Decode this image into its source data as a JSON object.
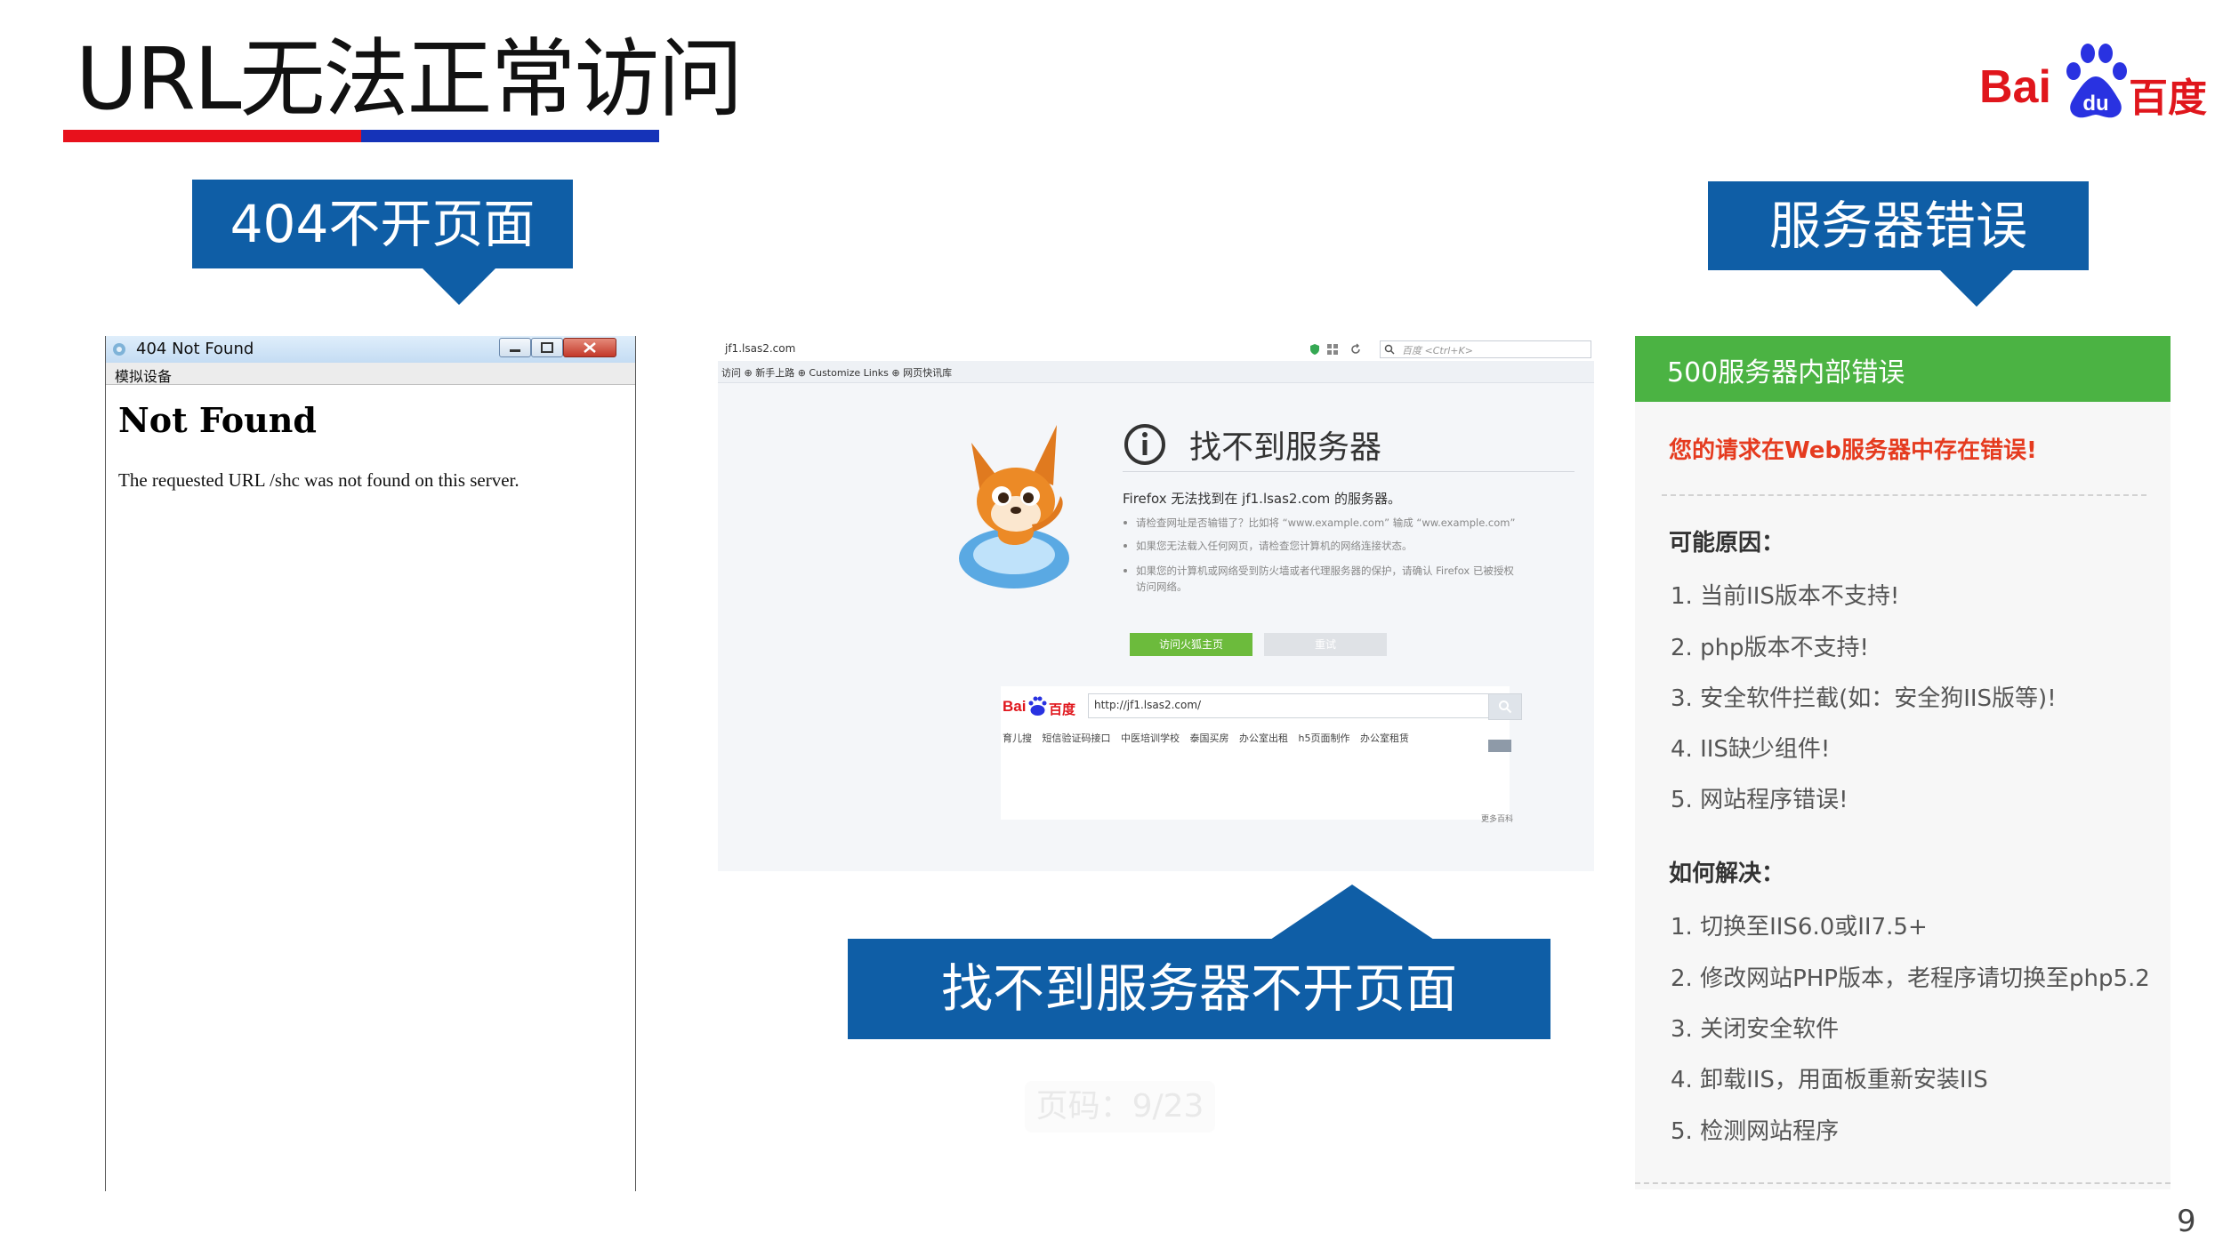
{
  "title": "URL无法正常访问",
  "logo": {
    "latin": "Bai",
    "paw": "du",
    "chinese": "百度"
  },
  "callouts": {
    "c404": "404不开页面",
    "server_error": "服务器错误",
    "not_found_server": "找不到服务器不开页面"
  },
  "window_404": {
    "title": "404 Not Found",
    "menu": "模拟设备",
    "heading": "Not Found",
    "message": "The requested URL /shc was not found on this server."
  },
  "firefox": {
    "url": "jf1.lsas2.com",
    "search_placeholder": "百度 <Ctrl+K>",
    "bookmarks": "访问  ⊕ 新手上路  ⊕ Customize Links  ⊕ 网页快讯库",
    "heading": "找不到服务器",
    "subtitle": "Firefox 无法找到在 jf1.lsas2.com 的服务器。",
    "bullets": [
      "请检查网址是否输错了？比如将 “www.example.com” 输成 “ww.example.com”",
      "如果您无法载入任何网页，请检查您计算机的网络连接状态。",
      "如果您的计算机或网络受到防火墙或者代理服务器的保护，请确认 Firefox 已被授权",
      "访问网络。"
    ],
    "button_home": "访问火狐主页",
    "button_retry": "重试",
    "baidu_logo_text": "Bai",
    "baidu_logo_cn": "百度",
    "baidu_input": "http://jf1.lsas2.com/",
    "baidu_links": "育儿搜  短信验证码接口  中医培训学校  泰国买房  办公室出租  h5页面制作  办公室租赁",
    "baidu_corner": "更多百科"
  },
  "error_500": {
    "header": "500服务器内部错误",
    "alert": "您的请求在Web服务器中存在错误!",
    "causes_title": "可能原因：",
    "causes": [
      "1. 当前IIS版本不支持!",
      "2. php版本不支持!",
      "3. 安全软件拦截(如：安全狗IIS版等)!",
      "4. IIS缺少组件!",
      "5. 网站程序错误!"
    ],
    "solutions_title": "如何解决：",
    "solutions": [
      "1. 切换至IIS6.0或II7.5+",
      "2. 修改网站PHP版本，老程序请切换至php5.2",
      "3. 关闭安全软件",
      "4. 卸载IIS，用面板重新安装IIS",
      "5. 检测网站程序"
    ]
  },
  "page_watermark": "页码：9/23",
  "page_number": "9",
  "colors": {
    "callout_blue": "#0f5ea6",
    "underline_red": "#e8111c",
    "underline_blue": "#1533b8",
    "green_header": "#4bb343",
    "alert_red": "#e53b1f",
    "baidu_red": "#e0161c",
    "baidu_blue": "#2932e1"
  }
}
